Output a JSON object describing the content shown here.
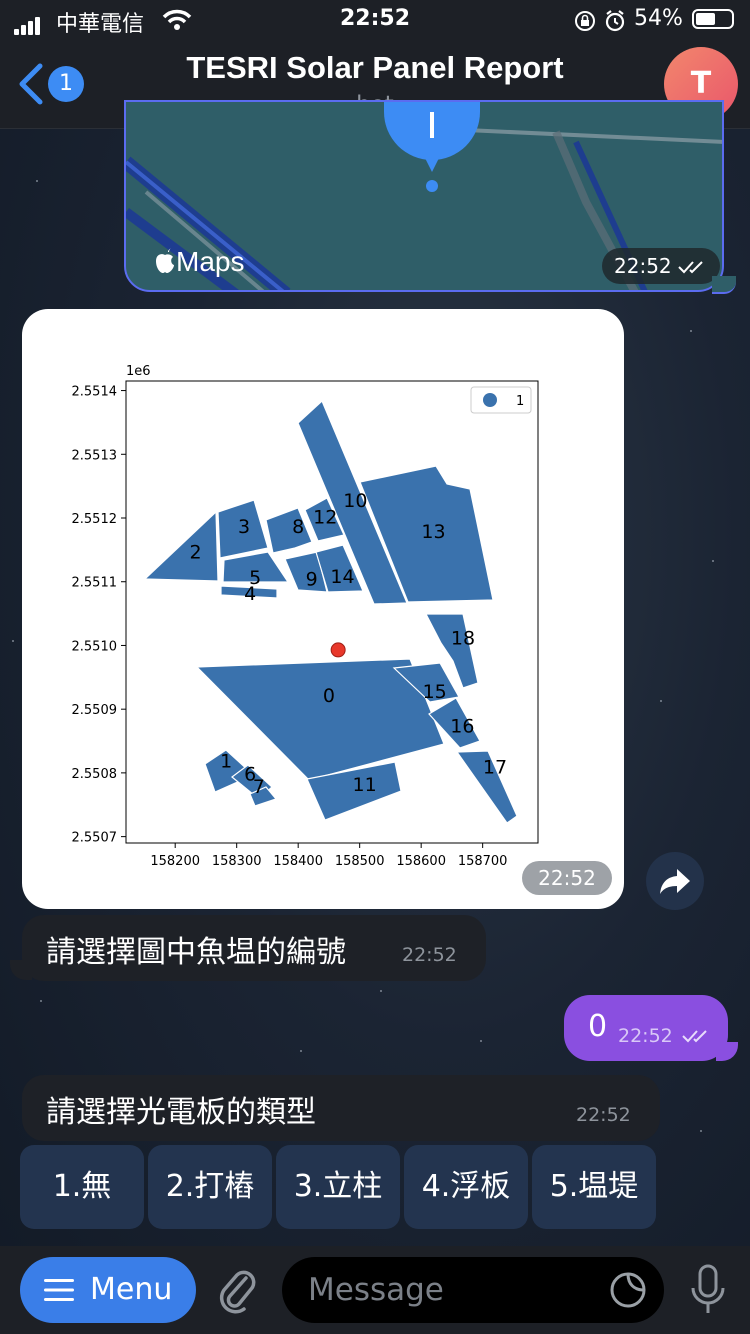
{
  "status_bar": {
    "carrier": "中華電信",
    "time": "22:52",
    "battery_percent": "54%"
  },
  "header": {
    "back_badge": "1",
    "title": "TESRI Solar Panel Report",
    "subtitle": "bot",
    "avatar_letter": "T"
  },
  "map_message": {
    "provider_label": "Maps",
    "time": "22:52"
  },
  "chart_message": {
    "time": "22:52"
  },
  "chart_data": {
    "type": "scatter",
    "title": "",
    "xlabel": "",
    "ylabel": "",
    "y_scale_label": "1e6",
    "legend": [
      "1"
    ],
    "legend_position": "top-right",
    "x_ticks": [
      "158200",
      "158300",
      "158400",
      "158500",
      "158600",
      "158700"
    ],
    "y_ticks": [
      "2.5507",
      "2.5508",
      "2.5509",
      "2.5510",
      "2.5511",
      "2.5512",
      "2.5513",
      "2.5514"
    ],
    "xlim": [
      158120,
      158790
    ],
    "ylim": [
      2550690,
      2551415
    ],
    "polygon_color": "#3a72ad",
    "marker_color": "#e8382b",
    "marker": {
      "x": 158465,
      "y": 2550993
    },
    "polygon_labels": [
      {
        "label": "0",
        "x": 158450,
        "y": 2550920
      },
      {
        "label": "1",
        "x": 158283,
        "y": 2550817
      },
      {
        "label": "2",
        "x": 158233,
        "y": 2551145
      },
      {
        "label": "3",
        "x": 158312,
        "y": 2551185
      },
      {
        "label": "4",
        "x": 158322,
        "y": 2551080
      },
      {
        "label": "5",
        "x": 158330,
        "y": 2551105
      },
      {
        "label": "6",
        "x": 158322,
        "y": 2550797
      },
      {
        "label": "7",
        "x": 158336,
        "y": 2550777
      },
      {
        "label": "8",
        "x": 158400,
        "y": 2551185
      },
      {
        "label": "9",
        "x": 158422,
        "y": 2551103
      },
      {
        "label": "10",
        "x": 158493,
        "y": 2551226
      },
      {
        "label": "11",
        "x": 158508,
        "y": 2550780
      },
      {
        "label": "12",
        "x": 158444,
        "y": 2551200
      },
      {
        "label": "13",
        "x": 158620,
        "y": 2551177
      },
      {
        "label": "14",
        "x": 158472,
        "y": 2551107
      },
      {
        "label": "15",
        "x": 158622,
        "y": 2550926
      },
      {
        "label": "16",
        "x": 158667,
        "y": 2550872
      },
      {
        "label": "17",
        "x": 158720,
        "y": 2550808
      },
      {
        "label": "18",
        "x": 158668,
        "y": 2551010
      }
    ]
  },
  "messages": {
    "prompt_pond": {
      "text": "請選擇圖中魚塭的編號",
      "time": "22:52"
    },
    "reply": {
      "text": "0",
      "time": "22:52"
    },
    "prompt_type": {
      "text": "請選擇光電板的類型",
      "time": "22:52"
    }
  },
  "keyboard": [
    "1.無",
    "2.打樁",
    "3.立柱",
    "4.浮板",
    "5.塭堤"
  ],
  "bottom_bar": {
    "menu_label": "Menu",
    "message_placeholder": "Message"
  }
}
